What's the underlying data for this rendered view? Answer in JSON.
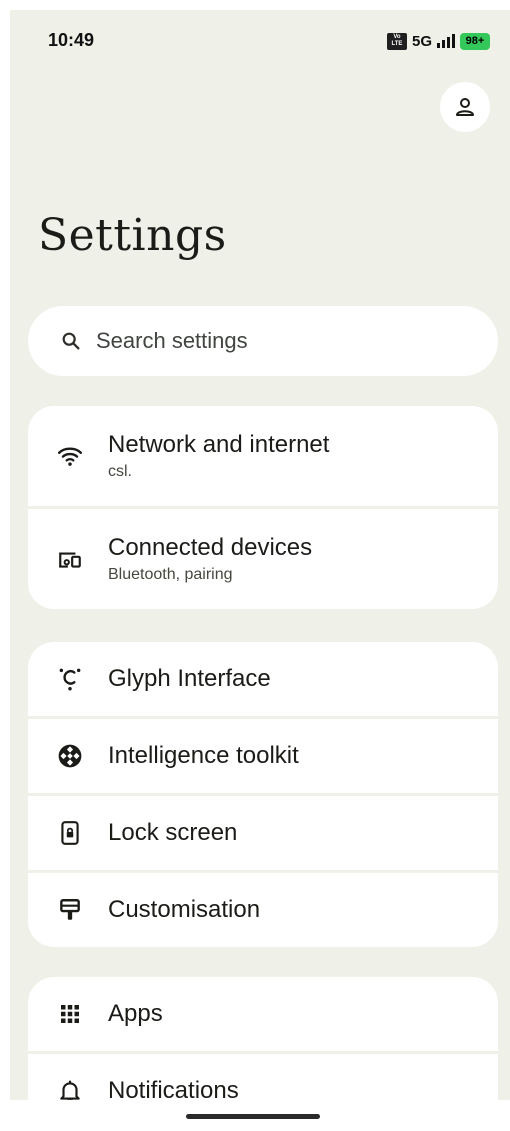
{
  "status_bar": {
    "time": "10:49",
    "volte_top": "Vo",
    "volte_bottom": "LTE",
    "network": "5G",
    "battery": "98+"
  },
  "header": {
    "title": "Settings"
  },
  "search": {
    "placeholder": "Search settings"
  },
  "groups": [
    {
      "items": [
        {
          "label": "Network and internet",
          "sub": "csl.",
          "icon": "wifi-icon"
        },
        {
          "label": "Connected devices",
          "sub": "Bluetooth, pairing",
          "icon": "connected-devices-icon"
        }
      ]
    },
    {
      "items": [
        {
          "label": "Glyph Interface",
          "icon": "glyph-icon"
        },
        {
          "label": "Intelligence toolkit",
          "icon": "intelligence-icon"
        },
        {
          "label": "Lock screen",
          "icon": "lock-screen-icon"
        },
        {
          "label": "Customisation",
          "icon": "customisation-icon"
        }
      ]
    },
    {
      "items": [
        {
          "label": "Apps",
          "icon": "apps-grid-icon"
        },
        {
          "label": "Notifications",
          "icon": "bell-icon"
        }
      ]
    }
  ],
  "colors": {
    "background": "#eff1e8",
    "card": "#ffffff",
    "text": "#1b1c18",
    "battery": "#34c759"
  }
}
